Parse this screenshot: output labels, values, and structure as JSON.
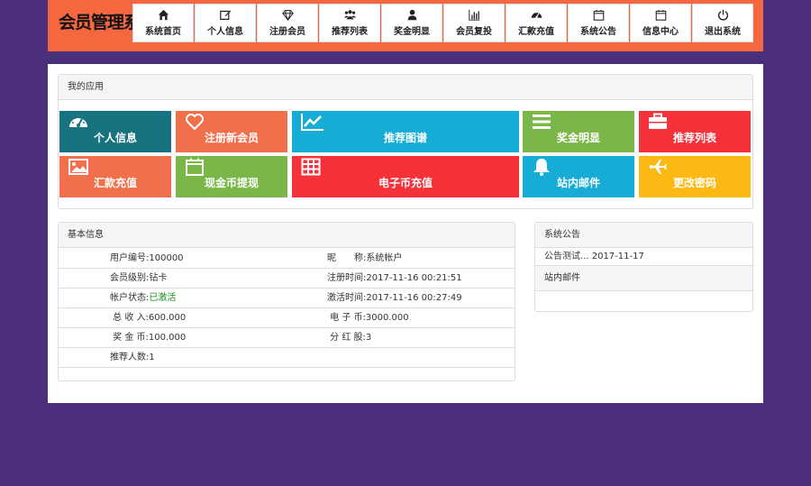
{
  "header": {
    "logo": "会员管理系统",
    "nav": [
      {
        "label": "系统首页",
        "icon": "home-icon"
      },
      {
        "label": "个人信息",
        "icon": "edit-icon"
      },
      {
        "label": "注册会员",
        "icon": "diamond-icon"
      },
      {
        "label": "推荐列表",
        "icon": "users-icon"
      },
      {
        "label": "奖金明显",
        "icon": "user-icon"
      },
      {
        "label": "会员复投",
        "icon": "bar-chart-icon"
      },
      {
        "label": "汇款充值",
        "icon": "dashboard-icon"
      },
      {
        "label": "系统公告",
        "icon": "calendar-icon"
      },
      {
        "label": "信息中心",
        "icon": "calendar-icon"
      },
      {
        "label": "退出系统",
        "icon": "power-icon"
      }
    ]
  },
  "apps": {
    "title": "我的应用",
    "tiles": [
      {
        "label": "个人信息",
        "icon": "dashboard-icon",
        "color": "#16737f"
      },
      {
        "label": "注册新会员",
        "icon": "heart-icon",
        "color": "#f0704b"
      },
      {
        "label": "推荐图谱",
        "icon": "line-chart-icon",
        "color": "#17acd6"
      },
      {
        "label": "奖金明显",
        "icon": "list-icon",
        "color": "#7ab648"
      },
      {
        "label": "推荐列表",
        "icon": "briefcase-icon",
        "color": "#f5313a"
      },
      {
        "label": "汇款充值",
        "icon": "picture-icon",
        "color": "#f0704b"
      },
      {
        "label": "现金币提现",
        "icon": "calendar-icon",
        "color": "#7ab648"
      },
      {
        "label": "电子币充值",
        "icon": "grid-icon",
        "color": "#f5313a"
      },
      {
        "label": "站内邮件",
        "icon": "bell-icon",
        "color": "#17acd6"
      },
      {
        "label": "更改密码",
        "icon": "plane-icon",
        "color": "#fdb913"
      }
    ]
  },
  "basic": {
    "title": "基本信息",
    "rows": [
      [
        "用户编号:100000",
        "昵　　称:系统帐户"
      ],
      [
        "会员级别:钻卡",
        "注册时间:2017-11-16 00:21:51"
      ],
      [
        "帐户状态:",
        "激活时间:2017-11-16 00:27:49"
      ],
      [
        " 总 收 入:600.000",
        " 电 子 币:3000.000"
      ],
      [
        " 奖 金 币:100.000",
        " 分 红 股:3"
      ],
      [
        "推荐人数:1",
        ""
      ]
    ],
    "status_value": "已激活"
  },
  "notice": {
    "title": "系统公告",
    "items": [
      "公告测试... 2017-11-17"
    ],
    "mail_title": "站内邮件"
  }
}
